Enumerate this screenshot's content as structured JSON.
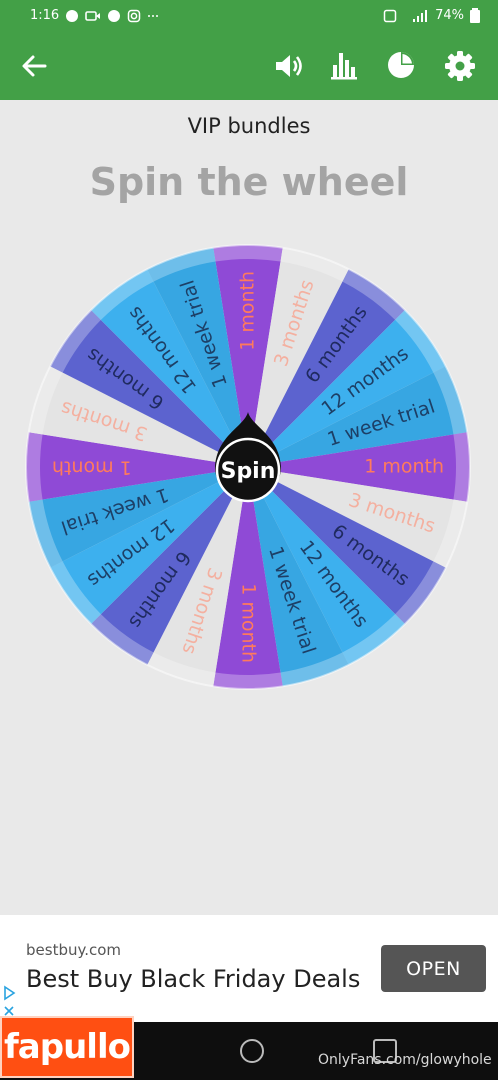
{
  "status_bar": {
    "time": "1:16",
    "battery": "74%"
  },
  "header": {
    "icons": [
      "back-arrow-icon",
      "sound-icon",
      "stats-icon",
      "pie-chart-icon",
      "gear-icon"
    ]
  },
  "page": {
    "subtitle": "VIP bundles",
    "title": "Spin the wheel"
  },
  "wheel": {
    "center_label": "Spin",
    "segments": [
      {
        "label": "1 month",
        "bg": "#8f4ad6",
        "fg": "#ff7a5c"
      },
      {
        "label": "3 months",
        "bg": "#e4e4e4",
        "fg": "#f4b0a0"
      },
      {
        "label": "6 months",
        "bg": "#5c63cf",
        "fg": "#1f2a5f"
      },
      {
        "label": "12 months",
        "bg": "#3db0ee",
        "fg": "#1d3f66"
      },
      {
        "label": "1 week trial",
        "bg": "#37a6e2",
        "fg": "#1d3f66"
      },
      {
        "label": "1 month",
        "bg": "#8f4ad6",
        "fg": "#ff7a5c"
      },
      {
        "label": "3 months",
        "bg": "#e4e4e4",
        "fg": "#f4b0a0"
      },
      {
        "label": "6 months",
        "bg": "#5c63cf",
        "fg": "#1f2a5f"
      },
      {
        "label": "12 months",
        "bg": "#3db0ee",
        "fg": "#1d3f66"
      },
      {
        "label": "1 week trial",
        "bg": "#37a6e2",
        "fg": "#1d3f66"
      },
      {
        "label": "1 month",
        "bg": "#8f4ad6",
        "fg": "#ff7a5c"
      },
      {
        "label": "3 months",
        "bg": "#e4e4e4",
        "fg": "#f4b0a0"
      },
      {
        "label": "6 months",
        "bg": "#5c63cf",
        "fg": "#1f2a5f"
      },
      {
        "label": "12 months",
        "bg": "#3db0ee",
        "fg": "#1d3f66"
      },
      {
        "label": "1 week trial",
        "bg": "#37a6e2",
        "fg": "#1d3f66"
      },
      {
        "label": "1 month",
        "bg": "#8f4ad6",
        "fg": "#ff7a5c"
      },
      {
        "label": "3 months",
        "bg": "#e4e4e4",
        "fg": "#f4b0a0"
      },
      {
        "label": "6 months",
        "bg": "#5c63cf",
        "fg": "#1f2a5f"
      },
      {
        "label": "12 months",
        "bg": "#3db0ee",
        "fg": "#1d3f66"
      },
      {
        "label": "1 week trial",
        "bg": "#37a6e2",
        "fg": "#1d3f66"
      }
    ]
  },
  "ad": {
    "url": "bestbuy.com",
    "headline": "Best Buy Black Friday Deals",
    "button": "OPEN"
  },
  "watermark": {
    "logo": "fapullo",
    "text": "OnlyFans.com/glowyhole"
  },
  "colors": {
    "app_bar": "#43a047",
    "background": "#e9e9e9"
  }
}
